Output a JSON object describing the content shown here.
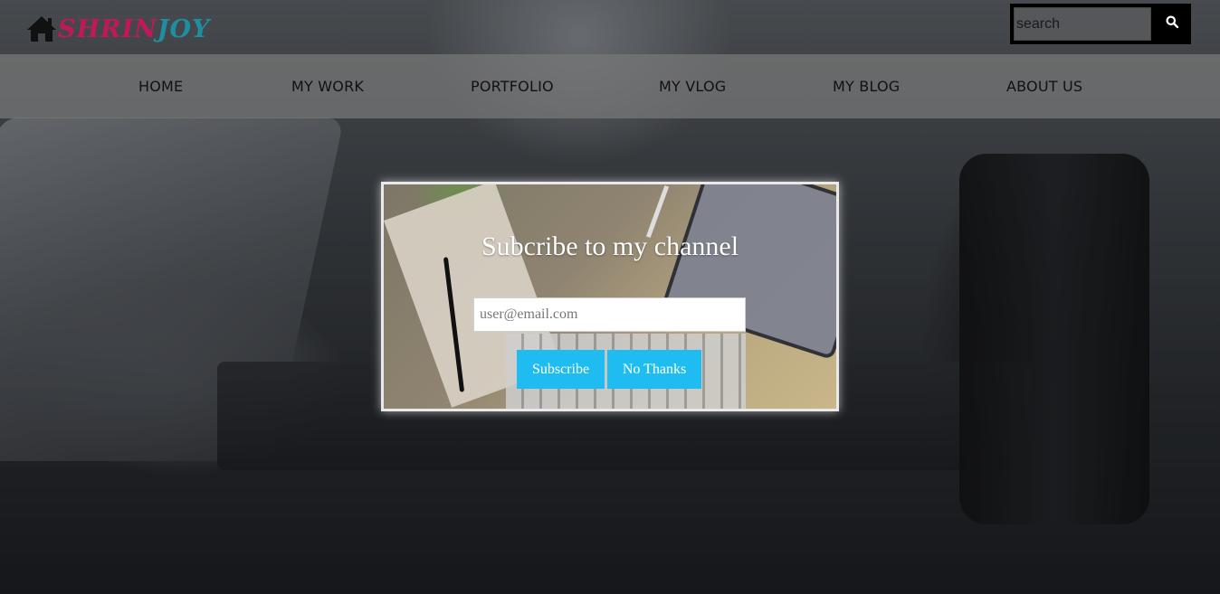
{
  "brand": {
    "part1": "SHRIN",
    "part2": "JOY",
    "colors": {
      "part1": "#c2185b",
      "part2": "#1e8fa0"
    }
  },
  "search": {
    "placeholder": "search",
    "icon": "search-icon"
  },
  "nav": {
    "items": [
      {
        "label": "HOME"
      },
      {
        "label": "MY WORK"
      },
      {
        "label": "PORTFOLIO"
      },
      {
        "label": "MY VLOG"
      },
      {
        "label": "MY BLOG"
      },
      {
        "label": "ABOUT US"
      }
    ]
  },
  "modal": {
    "title": "Subcribe to my channel",
    "email_placeholder": "user@email.com",
    "subscribe_label": "Subscribe",
    "no_thanks_label": "No Thanks",
    "accent": "#1ebcf0"
  }
}
